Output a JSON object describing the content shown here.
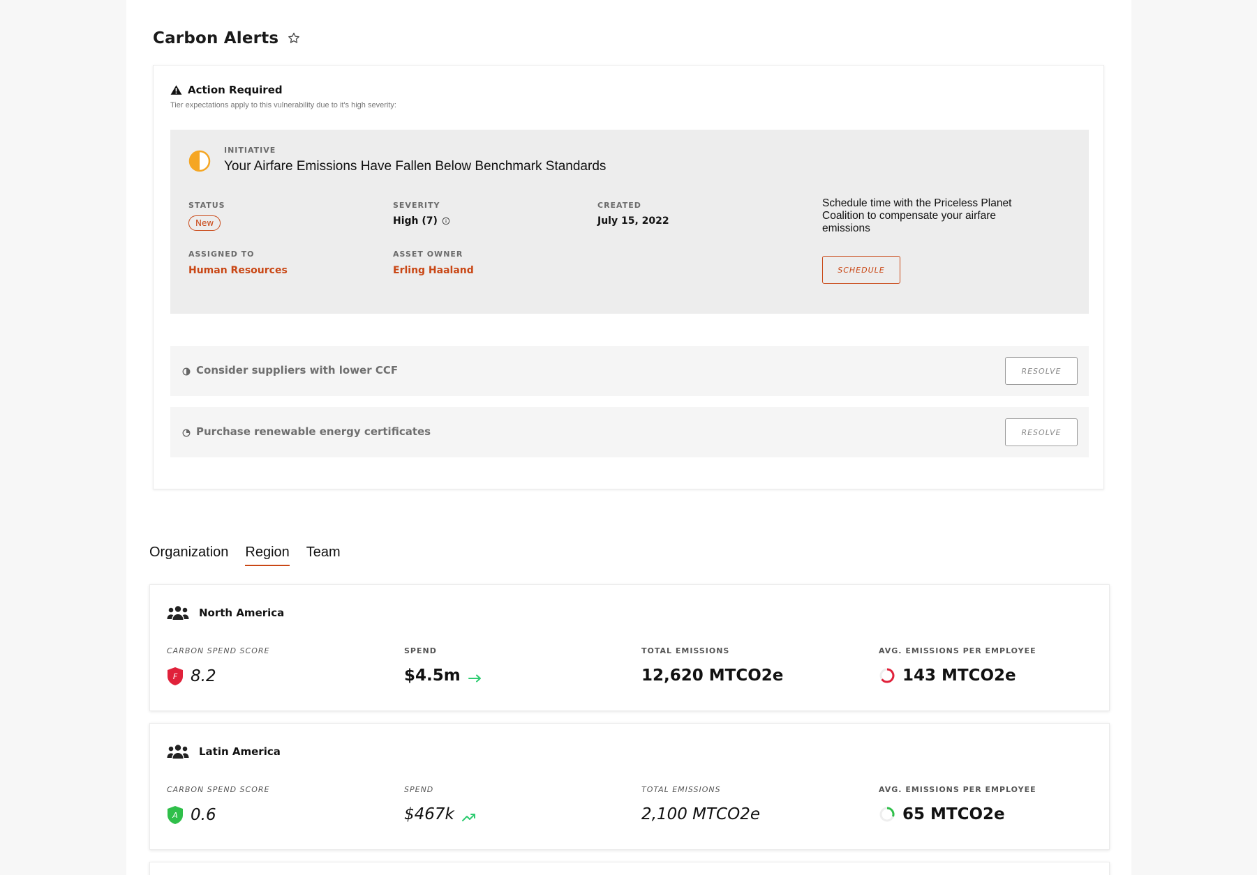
{
  "header": {
    "title": "Carbon Alerts",
    "favorite_icon": "star-icon"
  },
  "alert": {
    "heading": "Action Required",
    "subtitle": "Tier expectations apply to this vulnerability due to it's high severity:",
    "initiative": {
      "kicker": "INITIATIVE",
      "title": "Your Airfare Emissions Have Fallen Below Benchmark Standards",
      "icon": "half-circle-icon",
      "status_label": "STATUS",
      "status_value": "New",
      "severity_label": "SEVERITY",
      "severity_value": "High (7)",
      "created_label": "CREATED",
      "created_value": "July 15, 2022",
      "assigned_label": "ASSIGNED TO",
      "assigned_value": "Human Resources",
      "owner_label": "ASSET OWNER",
      "owner_value": "Erling Haaland",
      "cta_text": "Schedule time with the Priceless Planet Coalition to compensate your airfare emissions",
      "cta_button": "SCHEDULE"
    },
    "recommendations": [
      {
        "label": "Consider suppliers with lower CCF",
        "button": "RESOLVE",
        "icon": "half-circle-small-icon"
      },
      {
        "label": "Purchase renewable energy certificates",
        "button": "RESOLVE",
        "icon": "progress-circle-icon"
      }
    ]
  },
  "tabs": [
    {
      "label": "Organization",
      "active": false
    },
    {
      "label": "Region",
      "active": true
    },
    {
      "label": "Team",
      "active": false
    }
  ],
  "regions": [
    {
      "name": "North America",
      "score_label": "CARBON SPEND SCORE",
      "score_grade": "F",
      "score_value": "8.2",
      "spend_label": "SPEND",
      "spend_value": "$4.5m",
      "emissions_label": "TOTAL EMISSIONS",
      "emissions_value": "12,620 MTCO2e",
      "avg_label": "AVG. EMISSIONS PER EMPLOYEE",
      "avg_value": "143 MTCO2e"
    },
    {
      "name": "Latin America",
      "score_label": "CARBON SPEND SCORE",
      "score_grade": "A",
      "score_value": "0.6",
      "spend_label": "SPEND",
      "spend_value": "$467k",
      "emissions_label": "TOTAL EMISSIONS",
      "emissions_value": "2,100 MTCO2e",
      "avg_label": "AVG. EMISSIONS PER EMPLOYEE",
      "avg_value": "65 MTCO2e"
    }
  ],
  "colors": {
    "accent": "#c94715",
    "grade_f": "#e0213a",
    "grade_a": "#2fbf4a",
    "trend": "#2ecc71"
  }
}
